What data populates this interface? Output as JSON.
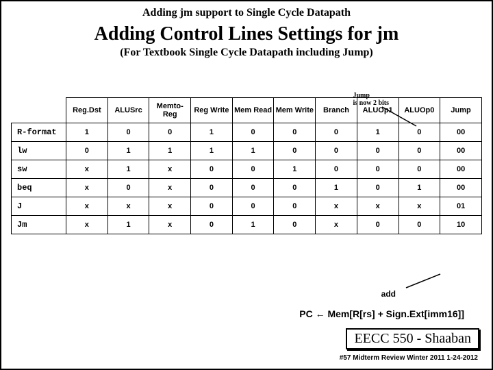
{
  "top_caption": "Adding  jm support to Single Cycle Datapath",
  "main_title": "Adding Control Lines Settings for jm",
  "subtitle": "(For Textbook Single Cycle Datapath including Jump)",
  "note_line1": "Jump",
  "note_line2": "is now 2 bits",
  "columns": [
    "Reg.Dst",
    "ALUSrc",
    "Memto-Reg",
    "Reg Write",
    "Mem Read",
    "Mem Write",
    "Branch",
    "ALUOp1",
    "ALUOp0",
    "Jump"
  ],
  "rows": [
    {
      "label": "R-format",
      "cells": [
        "1",
        "0",
        "0",
        "1",
        "0",
        "0",
        "0",
        "1",
        "0",
        "00"
      ]
    },
    {
      "label": "lw",
      "cells": [
        "0",
        "1",
        "1",
        "1",
        "1",
        "0",
        "0",
        "0",
        "0",
        "00"
      ]
    },
    {
      "label": "sw",
      "cells": [
        "x",
        "1",
        "x",
        "0",
        "0",
        "1",
        "0",
        "0",
        "0",
        "00"
      ]
    },
    {
      "label": "beq",
      "cells": [
        "x",
        "0",
        "x",
        "0",
        "0",
        "0",
        "1",
        "0",
        "1",
        "00"
      ]
    },
    {
      "label": "J",
      "cells": [
        "x",
        "x",
        "x",
        "0",
        "0",
        "0",
        "x",
        "x",
        "x",
        "01"
      ]
    },
    {
      "label": "Jm",
      "cells": [
        "x",
        "1",
        "x",
        "0",
        "1",
        "0",
        "x",
        "0",
        "0",
        "10"
      ]
    }
  ],
  "add_label": "add",
  "equation": "PC  ←  Mem[R[rs] + Sign.Ext[imm16]]",
  "course_box": "EECC 550 - Shaaban",
  "footer": "#57   Midterm Review  Winter 2011 1-24-2012"
}
